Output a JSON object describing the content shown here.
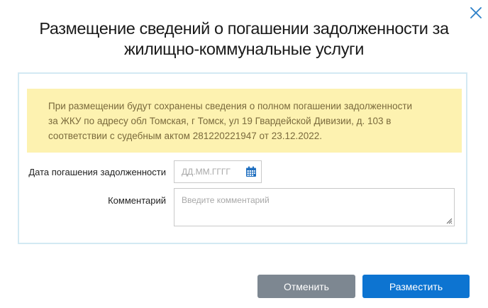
{
  "dialog": {
    "title_line1": "Размещение сведений о погашении задолженности за",
    "title_line2": "жилищно-коммунальные услуги",
    "close_icon": "close-icon"
  },
  "notice": {
    "line1": "При размещении будут сохранены сведения о полном погашении задолженности",
    "line2": "за ЖКУ по адресу обл Томская, г Томск, ул 19 Гвардейской Дивизии, д. 103 в",
    "line3": "соответствии с судебным актом 281220221947 от 23.12.2022."
  },
  "form": {
    "date_label": "Дата погашения задолженности",
    "date_placeholder": "ДД.ММ.ГГГГ",
    "date_value": "",
    "calendar_icon": "calendar-icon",
    "comment_label": "Комментарий",
    "comment_placeholder": "Введите комментарий",
    "comment_value": ""
  },
  "buttons": {
    "cancel": "Отменить",
    "submit": "Разместить"
  },
  "colors": {
    "notice_bg": "#fdf2b0",
    "notice_text": "#7a6a3c",
    "panel_border": "#d3e9f3",
    "primary": "#0d74d1",
    "secondary": "#7d8791",
    "close_icon": "#2b7fc8"
  }
}
